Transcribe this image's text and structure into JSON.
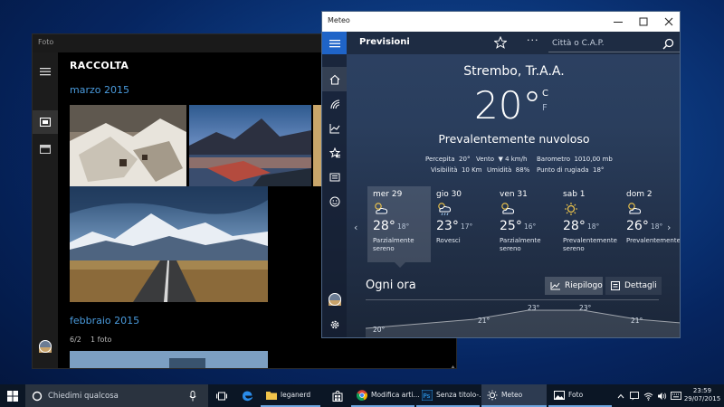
{
  "colors": {
    "accent": "#4a9bdd",
    "weather_bg": "#2a3e5d",
    "taskbar": "#0b1625"
  },
  "photos": {
    "title": "Foto",
    "header": "RACCOLTA",
    "months": [
      {
        "label": "marzo 2015"
      },
      {
        "label": "febbraio 2015",
        "count_date": "6/2",
        "count": "1 foto"
      }
    ],
    "rail_icons": [
      "hamburger-icon",
      "collection-icon",
      "album-icon",
      "avatar",
      "gear-icon"
    ]
  },
  "weather": {
    "title": "Meteo",
    "section": "Previsioni",
    "search_placeholder": "Città o C.A.P.",
    "city": "Strembo, Tr.A.A.",
    "temp": "20°",
    "unit_c": "C",
    "unit_f": "F",
    "condition": "Prevalentemente nuvoloso",
    "details": [
      {
        "label": "Percepita",
        "value": "20°"
      },
      {
        "label": "Vento",
        "value": "▼ 4 km/h"
      },
      {
        "label": "Barometro",
        "value": "1010,00 mb"
      },
      {
        "label": "Visibilità",
        "value": "10 Km"
      },
      {
        "label": "Umidità",
        "value": "88%"
      },
      {
        "label": "Punto di rugiada",
        "value": "18°"
      }
    ],
    "days": [
      {
        "day": "mer 29",
        "hi": "28°",
        "lo": "18°",
        "desc": "Parzialmente sereno",
        "icon": "partly-cloudy-icon"
      },
      {
        "day": "gio 30",
        "hi": "23°",
        "lo": "17°",
        "desc": "Rovesci",
        "icon": "showers-icon"
      },
      {
        "day": "ven 31",
        "hi": "25°",
        "lo": "16°",
        "desc": "Parzialmente sereno",
        "icon": "partly-cloudy-icon"
      },
      {
        "day": "sab 1",
        "hi": "28°",
        "lo": "18°",
        "desc": "Prevalentemente sereno",
        "icon": "sunny-icon"
      },
      {
        "day": "dom 2",
        "hi": "26°",
        "lo": "18°",
        "desc": "Prevalentemente",
        "icon": "partly-cloudy-icon"
      }
    ],
    "hourly": {
      "title": "Ogni ora",
      "summary_label": "Riepilogo",
      "details_label": "Dettagli",
      "temps": [
        "20°",
        "21°",
        "23°",
        "23°",
        "21°"
      ]
    }
  },
  "taskbar": {
    "search_placeholder": "Chiedimi qualcosa",
    "apps": [
      {
        "label": "leganerd",
        "icon": "folder-icon"
      },
      {
        "label": "Modifica arti...",
        "icon": "chrome-icon"
      },
      {
        "label": "Senza titolo-...",
        "icon": "photoshop-icon"
      },
      {
        "label": "Meteo",
        "icon": "weather-icon"
      },
      {
        "label": "Foto",
        "icon": "photos-icon"
      }
    ],
    "time": "23:59",
    "date": "29/07/2015"
  }
}
